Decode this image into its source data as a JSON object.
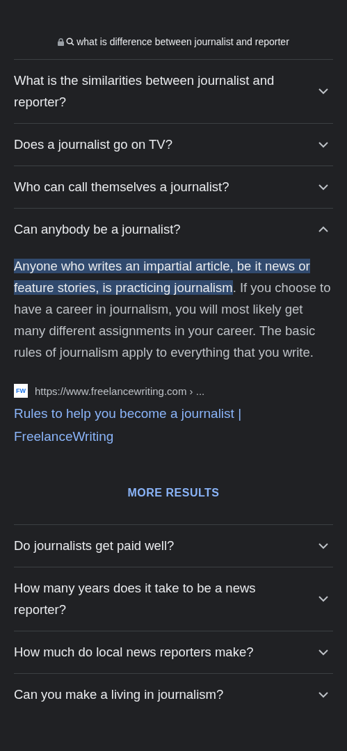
{
  "query": "what is difference between journalist and reporter",
  "faqs": [
    {
      "question": "What is the similarities between journalist and reporter?",
      "expanded": false
    },
    {
      "question": "Does a journalist go on TV?",
      "expanded": false
    },
    {
      "question": "Who can call themselves a journalist?",
      "expanded": false
    },
    {
      "question": "Can anybody be a journalist?",
      "expanded": true,
      "answer": {
        "highlight": "Anyone who writes an impartial article, be it news or feature stories, is practicing journalism",
        "rest": ". If you choose to have a career in journalism, you will most likely get many different assignments in your career. The basic rules of journalism apply to everything that you write.",
        "favicon": "FW",
        "url": "https://www.freelancewriting.com › ...",
        "title": "Rules to help you become a journalist | FreelanceWriting"
      }
    }
  ],
  "more_results": "MORE RESULTS",
  "more_faqs": [
    {
      "question": "Do journalists get paid well?",
      "expanded": false
    },
    {
      "question": "How many years does it take to be a news reporter?",
      "expanded": false
    },
    {
      "question": "How much do local news reporters make?",
      "expanded": false
    },
    {
      "question": "Can you make a living in journalism?",
      "expanded": false
    }
  ]
}
